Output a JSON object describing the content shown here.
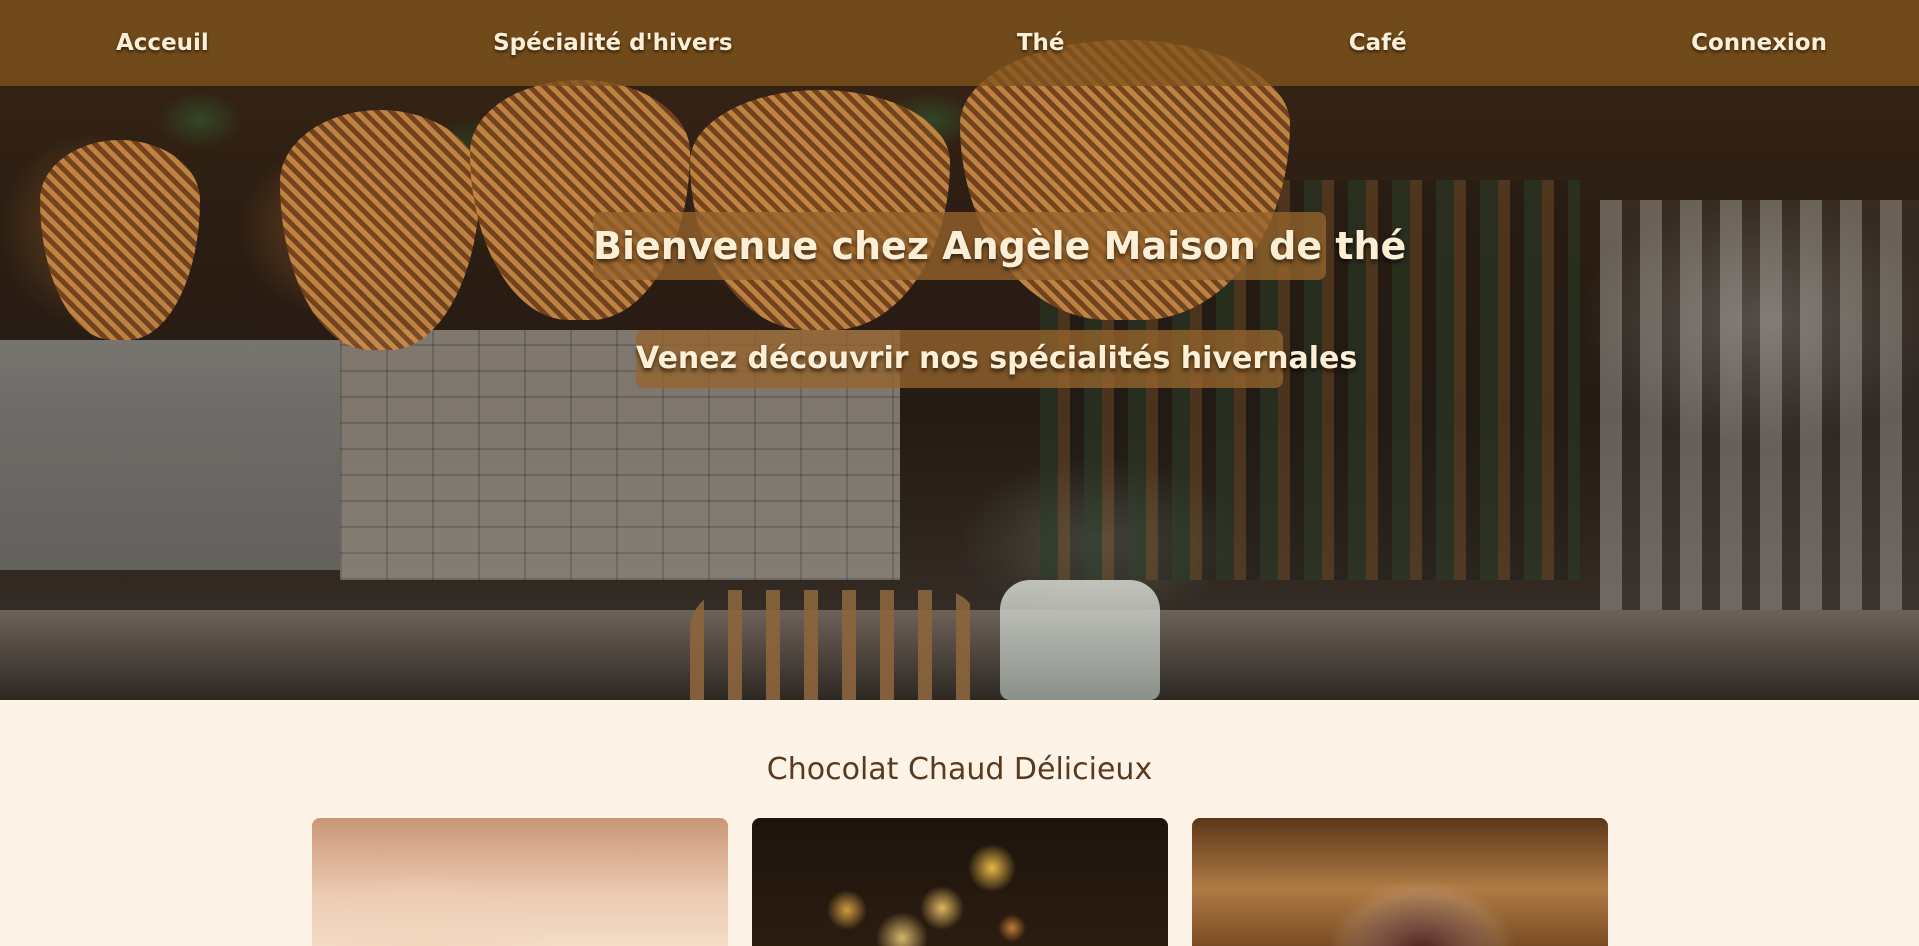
{
  "nav": {
    "items": [
      {
        "label": "Acceuil"
      },
      {
        "label": "Spécialité d'hivers"
      },
      {
        "label": "Thé"
      },
      {
        "label": "Café"
      },
      {
        "label": "Connexion"
      }
    ]
  },
  "hero": {
    "title": "Bienvenue chez Angèle Maison de thé",
    "subtitle": "Venez découvrir nos spécialités hivernales"
  },
  "section": {
    "title": "Chocolat Chaud Délicieux"
  },
  "colors": {
    "nav_bg": "#82551e",
    "text_light": "#fcefd6",
    "page_bg": "#fdf3e6",
    "section_title": "#5a3a1e"
  }
}
